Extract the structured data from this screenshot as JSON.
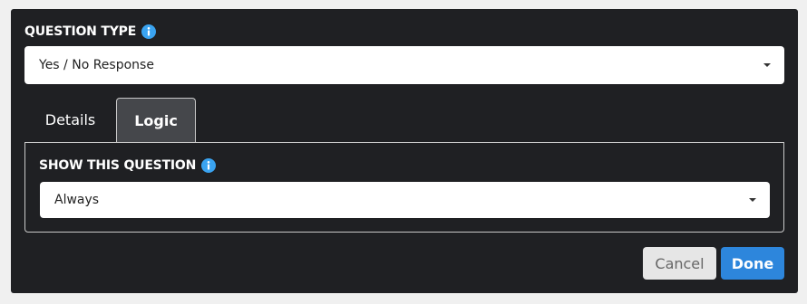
{
  "question_type": {
    "label": "QUESTION TYPE",
    "info_icon": "info-icon",
    "selected_value": "Yes / No Response"
  },
  "tabs": [
    {
      "label": "Details",
      "active": false
    },
    {
      "label": "Logic",
      "active": true
    }
  ],
  "logic": {
    "show_label": "SHOW THIS QUESTION",
    "info_icon": "info-icon",
    "selected_value": "Always"
  },
  "buttons": {
    "cancel_label": "Cancel",
    "done_label": "Done"
  },
  "colors": {
    "panel_background": "#1f2023",
    "active_tab_background": "#45474b",
    "info_icon": "#3aa3f0",
    "primary_button": "#2d86dc",
    "secondary_button": "#e6e6e6"
  }
}
